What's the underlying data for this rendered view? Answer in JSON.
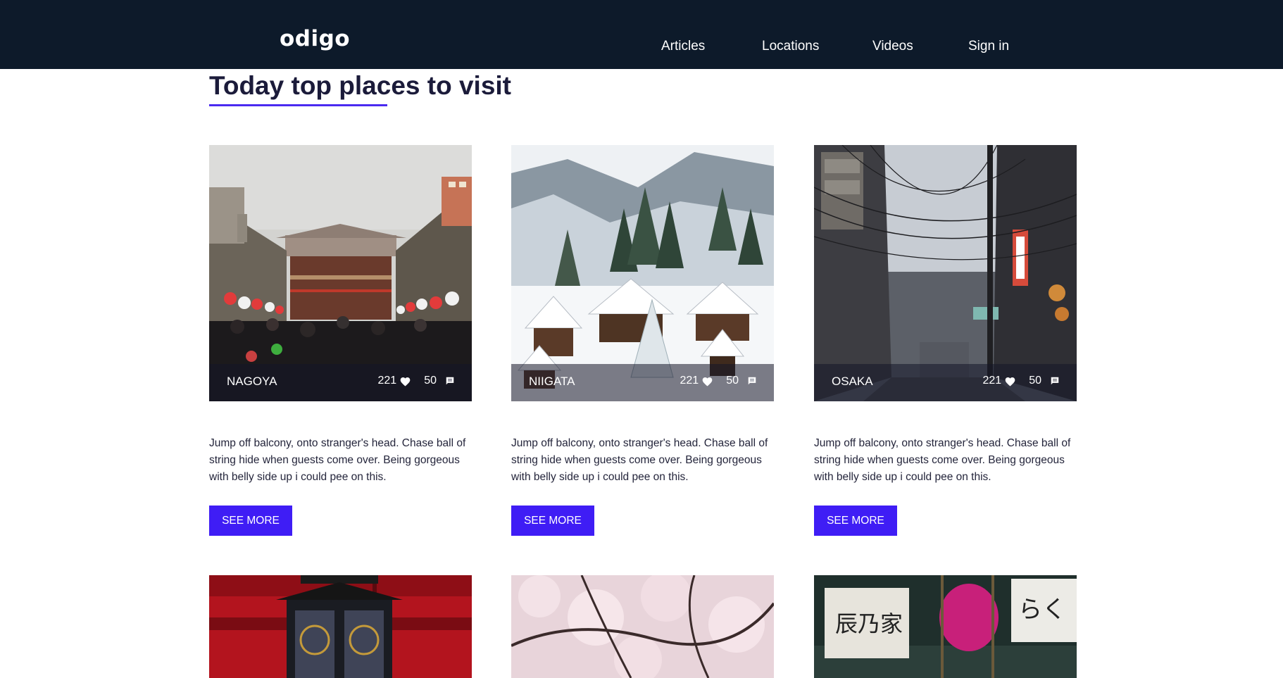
{
  "brand": {
    "logo": "odigo"
  },
  "nav": {
    "items": [
      {
        "label": "Articles"
      },
      {
        "label": "Locations"
      },
      {
        "label": "Videos"
      },
      {
        "label": "Sign in"
      }
    ]
  },
  "main": {
    "title": "Today top places to visit",
    "cards": [
      {
        "city": "NAGOYA",
        "likes": "221",
        "comments": "50",
        "description": "Jump off balcony, onto stranger's head. Chase ball of string hide when guests come over. Being gorgeous with belly side up i could pee on this.",
        "button": "SEE MORE"
      },
      {
        "city": "NIIGATA",
        "likes": "221",
        "comments": "50",
        "description": "Jump off balcony, onto stranger's head. Chase ball of string hide when guests come over. Being gorgeous with belly side up i could pee on this.",
        "button": "SEE MORE"
      },
      {
        "city": "OSAKA",
        "likes": "221",
        "comments": "50",
        "description": "Jump off balcony, onto stranger's head. Chase ball of string hide when guests come over. Being gorgeous with belly side up i could pee on this.",
        "button": "SEE MORE"
      }
    ]
  },
  "icons": {
    "likes": "heart-icon",
    "comments": "comment-icon"
  },
  "colors": {
    "header_bg": "#0d1a2a",
    "accent": "#3f1df5",
    "title_text": "#1b1b3a",
    "underline": "#4a2af0"
  }
}
